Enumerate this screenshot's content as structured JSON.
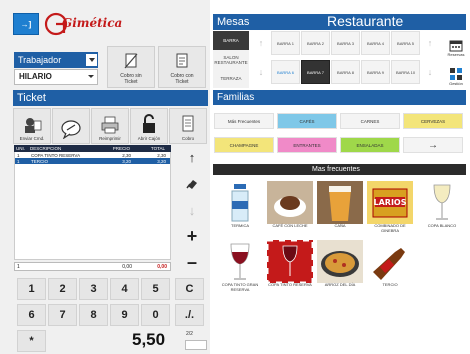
{
  "header": {
    "logout_label": "→]",
    "logo_text": "Gimética"
  },
  "worker": {
    "label": "Trabajador",
    "value": "HILARIO"
  },
  "actions": {
    "charge_no_ticket": "Cobro sin\nTicket",
    "charge_with_ticket": "Cobro con\nTicket"
  },
  "ticket": {
    "title": "Ticket",
    "buttons": [
      "Enviar Cmd.",
      "",
      "Reimprimir",
      "Abrir Cajón",
      "Cobro"
    ],
    "columns": [
      "UNI.",
      "DESCRIPCION",
      "PRECIO",
      "TOTAL"
    ],
    "rows": [
      {
        "qty": "1",
        "desc": "COPA TINTO RESERVA",
        "price": "2,30",
        "total": "2,30"
      },
      {
        "qty": "1",
        "desc": "TERCIO",
        "price": "3,20",
        "total": "3,20"
      }
    ],
    "totals": {
      "qty": "1",
      "a": "0,00",
      "b": "0,00"
    },
    "total_amount": "5,50",
    "page": "2/2"
  },
  "keypad": [
    "1",
    "2",
    "3",
    "4",
    "5",
    "C",
    "6",
    "7",
    "8",
    "9",
    "0",
    "./.",
    "*"
  ],
  "mesas": {
    "title": "Mesas",
    "area_title": "Restaurante",
    "zones": [
      "BARRA",
      "SALON\nRESTAURANTE",
      "TERRAZA"
    ],
    "tables_row1": [
      "BARRA 1",
      "BARRA 2",
      "BARRA 3",
      "BARRA 4",
      "BARRA 5"
    ],
    "tables_row2": [
      "BARRA 6",
      "BARRA 7",
      "BARRA 8",
      "BARRA 9",
      "BARRA 10"
    ],
    "right_icons": [
      "Reservas",
      "Gestión"
    ]
  },
  "familias": {
    "title": "Familias",
    "items": [
      {
        "label": "Más Frecuentes",
        "color": "#f4f4f4"
      },
      {
        "label": "CAFÉS",
        "color": "#7fc8e8"
      },
      {
        "label": "CARNES",
        "color": "#f4f4f4"
      },
      {
        "label": "CERVEZAS",
        "color": "#f3e57a"
      },
      {
        "label": "CHAMPAGNE",
        "color": "#f3e57a"
      },
      {
        "label": "ENTRANTES",
        "color": "#f08ac8"
      },
      {
        "label": "ENSALADAS",
        "color": "#9fd84a"
      },
      {
        "label": "→",
        "color": "#f4f4f4"
      }
    ]
  },
  "frecuentes": {
    "title": "Mas frecuentes",
    "products": [
      "TERMICA",
      "CAFÉ CON LECHE",
      "CAÑA",
      "COMBINADO DE GINEBRA",
      "COPA BLANCO",
      "COPA TINTO GRAN RESERVA",
      "COPA TINTO RESERVA",
      "ARROZ DEL DÍA",
      "TERCIO"
    ]
  },
  "colors": {
    "primary_blue": "#1f5fa5",
    "accent_red": "#c41a1a"
  }
}
